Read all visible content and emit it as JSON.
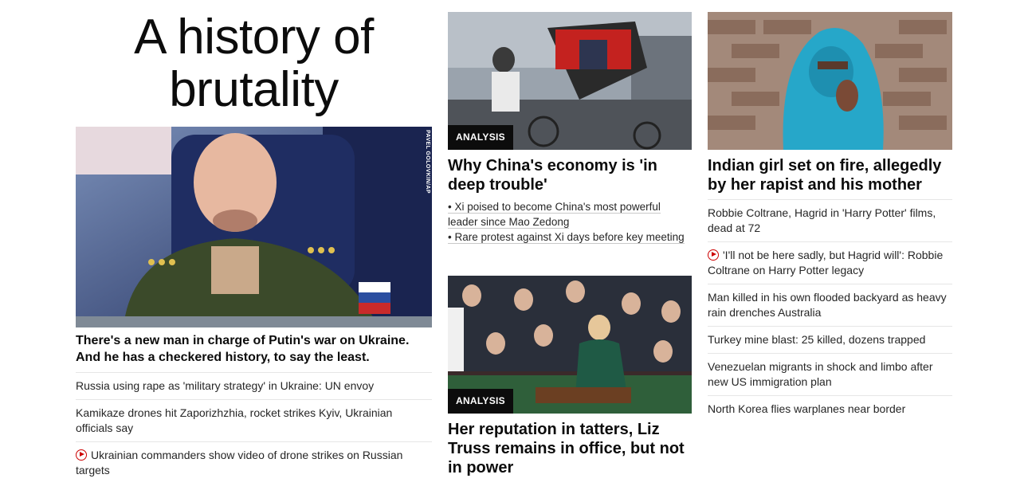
{
  "hero": {
    "title": "A history of brutality",
    "image_credit": "PAVEL GOLOVKIN/AP",
    "headline": "There's a new man in charge of Putin's war on Ukraine. And he has a checkered history, to say the least.",
    "related": [
      {
        "text": "Russia using rape as 'military strategy' in Ukraine: UN envoy",
        "video": false
      },
      {
        "text": "Kamikaze drones hit Zaporizhzhia, rocket strikes Kyiv, Ukrainian officials say",
        "video": false
      },
      {
        "text": "Ukrainian commanders show video of drone strikes on Russian targets",
        "video": true
      }
    ]
  },
  "middle": {
    "story1": {
      "badge": "ANALYSIS",
      "headline": "Why China's economy is 'in deep trouble'",
      "bullets": [
        "• Xi poised to become China's most powerful leader since Mao Zedong",
        "• Rare protest against Xi days before key meeting"
      ]
    },
    "story2": {
      "badge": "ANALYSIS",
      "headline": "Her reputation in tatters, Liz Truss remains in office, but not in power"
    }
  },
  "right": {
    "headline": "Indian girl set on fire, allegedly by her rapist and his mother",
    "items": [
      {
        "text": "Robbie Coltrane, Hagrid in 'Harry Potter' films, dead at 72",
        "video": false
      },
      {
        "text": "'I'll not be here sadly, but Hagrid will': Robbie Coltrane on Harry Potter legacy",
        "video": true
      },
      {
        "text": "Man killed in his own flooded backyard as heavy rain drenches Australia",
        "video": false
      },
      {
        "text": "Turkey mine blast: 25 killed, dozens trapped",
        "video": false
      },
      {
        "text": "Venezuelan migrants in shock and limbo after new US immigration plan",
        "video": false
      },
      {
        "text": "North Korea flies warplanes near border",
        "video": false
      }
    ]
  },
  "colors": {
    "accent_red": "#cc0000",
    "badge_bg": "#0c0c0c",
    "divider": "#e6e6e6"
  },
  "icons": {
    "video": "play-circle-icon"
  }
}
